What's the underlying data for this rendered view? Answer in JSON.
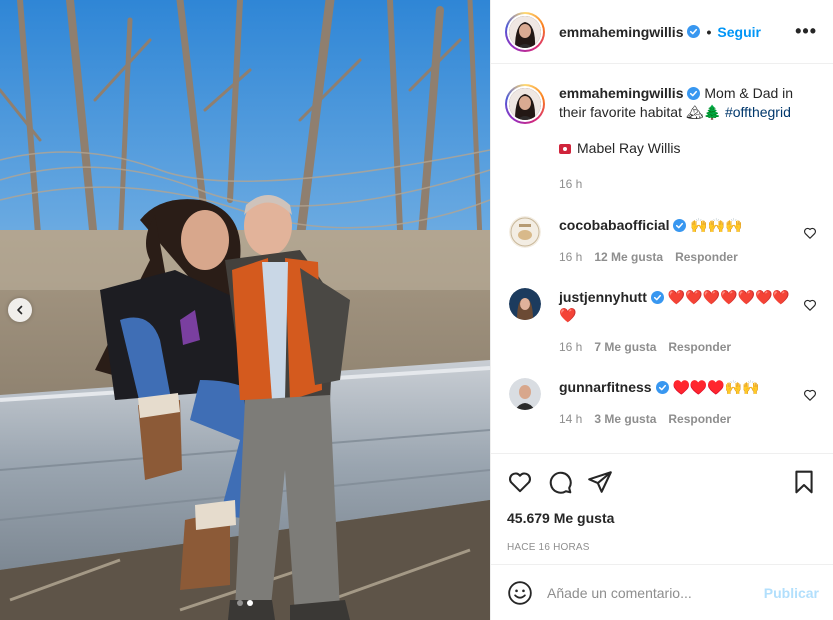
{
  "post": {
    "username": "emmahemingwillis",
    "separator": "•",
    "follow_label": "Seguir",
    "more_label": "•••",
    "photo_alt": "",
    "carousel": {
      "index": 2,
      "count": 2
    }
  },
  "caption": {
    "username": "emmahemingwillis",
    "text": "Mom & Dad in their favorite habitat 🏔🌲 ",
    "hashtag": "#offthegrid",
    "tagged": "Mabel Ray Willis",
    "time": "16 h"
  },
  "comments": [
    {
      "username": "cocobabaofficial",
      "text": "🙌🙌🙌",
      "time": "16 h",
      "likes": "12 Me gusta",
      "reply": "Responder"
    },
    {
      "username": "justjennyhutt",
      "text": "❤️❤️❤️❤️❤️❤️❤️❤️",
      "time": "16 h",
      "likes": "7 Me gusta",
      "reply": "Responder"
    },
    {
      "username": "gunnarfitness",
      "text": "♥️♥️♥️🙌🙌",
      "time": "14 h",
      "likes": "3 Me gusta",
      "reply": "Responder"
    }
  ],
  "footer": {
    "likes": "45.679 Me gusta",
    "ago": "HACE 16 HORAS",
    "comment_placeholder": "Añade un comentario...",
    "publish_label": "Publicar"
  },
  "colors": {
    "accent": "#0095f6",
    "verified": "#3897f0",
    "heart_red": "#ed4956"
  }
}
